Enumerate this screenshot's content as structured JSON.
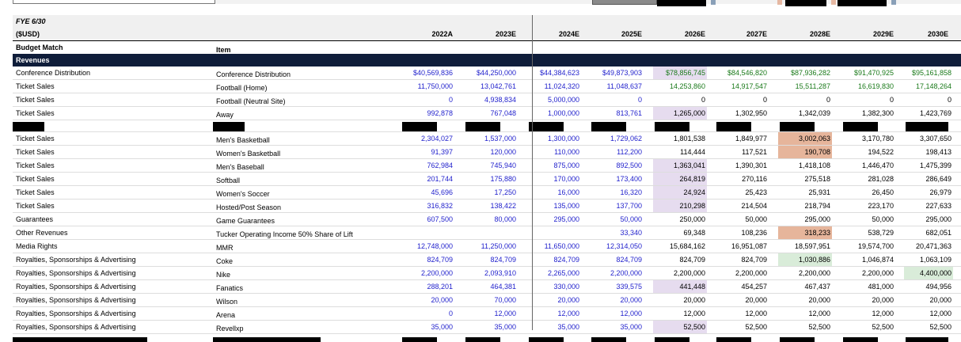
{
  "fiscal_label": "FYE 6/30",
  "currency_label": "($USD)",
  "budget_match_label": "Budget Match",
  "item_label": "Item",
  "section_label": "Revenues",
  "years": [
    "2022A",
    "2023E",
    "2024E",
    "2025E",
    "2026E",
    "2027E",
    "2028E",
    "2029E",
    "2030E"
  ],
  "colors": {
    "header_band": "#0f1d3a",
    "actual_blue": "#1f1fcc",
    "forecast_green": "#1a7a1a",
    "highlight_purple": "#e6dcef",
    "highlight_orange": "#e6b59b",
    "highlight_green": "#d9ecd9"
  },
  "rows": [
    {
      "cat": "Conference Distribution",
      "item": "Conference Distribution",
      "v": [
        "$40,569,836",
        "$44,250,000",
        "$44,384,623",
        "$49,873,903",
        "$78,856,745",
        "$84,546,820",
        "$87,936,282",
        "$91,470,925",
        "$95,161,858"
      ]
    },
    {
      "cat": "Ticket Sales",
      "item": "Football (Home)",
      "v": [
        "11,750,000",
        "13,042,761",
        "11,024,320",
        "11,048,637",
        "14,253,860",
        "14,917,547",
        "15,511,287",
        "16,619,830",
        "17,148,264"
      ]
    },
    {
      "cat": "Ticket Sales",
      "item": "Football (Neutral Site)",
      "v": [
        "0",
        "4,938,834",
        "5,000,000",
        "0",
        "0",
        "0",
        "0",
        "0",
        "0"
      ]
    },
    {
      "cat": "Ticket Sales",
      "item": "Away",
      "v": [
        "992,878",
        "767,048",
        "1,000,000",
        "813,761",
        "1,265,000",
        "1,302,950",
        "1,342,039",
        "1,382,300",
        "1,423,769"
      ]
    },
    {
      "cat": "Ticket Sales",
      "item": "Men's Basketball",
      "v": [
        "2,304,027",
        "1,537,000",
        "1,300,000",
        "1,729,062",
        "1,801,538",
        "1,849,977",
        "3,002,063",
        "3,170,780",
        "3,307,650"
      ]
    },
    {
      "cat": "Ticket Sales",
      "item": "Women's Basketball",
      "v": [
        "91,397",
        "120,000",
        "110,000",
        "112,200",
        "114,444",
        "117,521",
        "190,708",
        "194,522",
        "198,413"
      ]
    },
    {
      "cat": "Ticket Sales",
      "item": "Men's Baseball",
      "v": [
        "762,984",
        "745,940",
        "875,000",
        "892,500",
        "1,363,041",
        "1,390,301",
        "1,418,108",
        "1,446,470",
        "1,475,399"
      ]
    },
    {
      "cat": "Ticket Sales",
      "item": "Softball",
      "v": [
        "201,744",
        "175,880",
        "170,000",
        "173,400",
        "264,819",
        "270,116",
        "275,518",
        "281,028",
        "286,649"
      ]
    },
    {
      "cat": "Ticket Sales",
      "item": "Women's Soccer",
      "v": [
        "45,696",
        "17,250",
        "16,000",
        "16,320",
        "24,924",
        "25,423",
        "25,931",
        "26,450",
        "26,979"
      ]
    },
    {
      "cat": "Ticket Sales",
      "item": "Hosted/Post Season",
      "v": [
        "316,832",
        "138,422",
        "135,000",
        "137,700",
        "210,298",
        "214,504",
        "218,794",
        "223,170",
        "227,633"
      ]
    },
    {
      "cat": "Guarantees",
      "item": "Game Guarantees",
      "v": [
        "607,500",
        "80,000",
        "295,000",
        "50,000",
        "250,000",
        "50,000",
        "295,000",
        "50,000",
        "295,000"
      ]
    },
    {
      "cat": "Other Revenues",
      "item": "Tucker Operating Income 50% Share of Lift",
      "v": [
        "",
        "",
        "",
        "33,340",
        "69,348",
        "108,236",
        "318,233",
        "538,729",
        "682,051"
      ]
    },
    {
      "cat": "Media Rights",
      "item": "MMR",
      "v": [
        "12,748,000",
        "11,250,000",
        "11,650,000",
        "12,314,050",
        "15,684,162",
        "16,951,087",
        "18,597,951",
        "19,574,700",
        "20,471,363"
      ]
    },
    {
      "cat": "Royalties, Sponsorships & Advertising",
      "item": "Coke",
      "v": [
        "824,709",
        "824,709",
        "824,709",
        "824,709",
        "824,709",
        "824,709",
        "1,030,886",
        "1,046,874",
        "1,063,109"
      ]
    },
    {
      "cat": "Royalties, Sponsorships & Advertising",
      "item": "Nike",
      "v": [
        "2,200,000",
        "2,093,910",
        "2,265,000",
        "2,200,000",
        "2,200,000",
        "2,200,000",
        "2,200,000",
        "2,200,000",
        "4,400,000"
      ]
    },
    {
      "cat": "Royalties, Sponsorships & Advertising",
      "item": "Fanatics",
      "v": [
        "288,201",
        "464,381",
        "330,000",
        "339,575",
        "441,448",
        "454,257",
        "467,437",
        "481,000",
        "494,956"
      ]
    },
    {
      "cat": "Royalties, Sponsorships & Advertising",
      "item": "Wilson",
      "v": [
        "20,000",
        "70,000",
        "20,000",
        "20,000",
        "20,000",
        "20,000",
        "20,000",
        "20,000",
        "20,000"
      ]
    },
    {
      "cat": "Royalties, Sponsorships & Advertising",
      "item": "Arena",
      "v": [
        "0",
        "12,000",
        "12,000",
        "12,000",
        "12,000",
        "12,000",
        "12,000",
        "12,000",
        "12,000"
      ]
    },
    {
      "cat": "Royalties, Sponsorships & Advertising",
      "item": "Revellxp",
      "v": [
        "35,000",
        "35,000",
        "35,000",
        "35,000",
        "52,500",
        "52,500",
        "52,500",
        "52,500",
        "52,500"
      ]
    }
  ]
}
